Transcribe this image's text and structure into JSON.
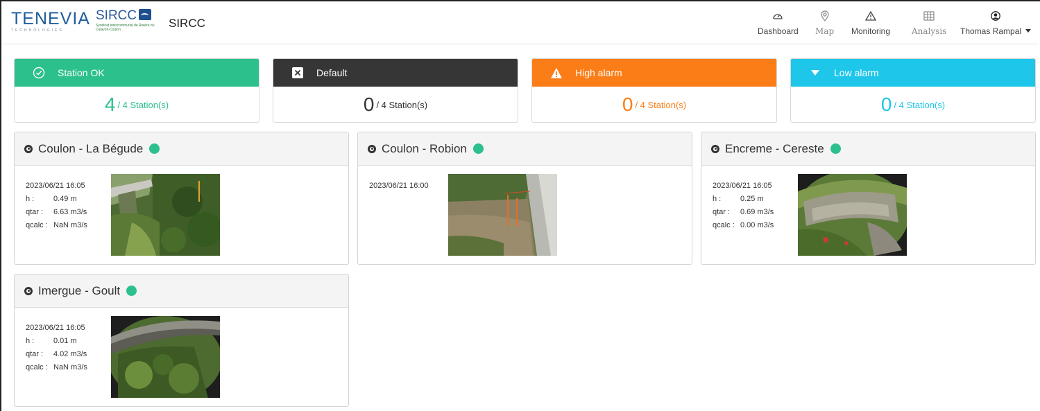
{
  "header": {
    "logo_main": "TENEVIA",
    "logo_main_sub": "TECHNOLOGIES",
    "logo_partner": "SIRCC",
    "logo_partner_tag": "Syndicat Intercommunal de Rivière du Calavon-Coulon",
    "app_title": "SIRCC"
  },
  "nav": {
    "dashboard": {
      "label": "Dashboard",
      "icon": "gauge-icon"
    },
    "map": {
      "label": "Map",
      "icon": "map-pin-icon"
    },
    "monitoring": {
      "label": "Monitoring",
      "icon": "warning-icon"
    },
    "analysis": {
      "label": "Analysis",
      "icon": "table-icon"
    },
    "user": {
      "label": "Thomas Rampal",
      "icon": "user-circle-icon"
    }
  },
  "summary": [
    {
      "label": "Station OK",
      "count": "4",
      "total": "/ 4 Station(s)",
      "color": "#2cc08d",
      "icon": "check-circle-icon"
    },
    {
      "label": "Default",
      "count": "0",
      "total": "/ 4 Station(s)",
      "color": "#363636",
      "icon": "x-box-icon"
    },
    {
      "label": "High alarm",
      "count": "0",
      "total": "/ 4 Station(s)",
      "color": "#fb7d17",
      "icon": "warning-triangle-icon"
    },
    {
      "label": "Low alarm",
      "count": "0",
      "total": "/ 4 Station(s)",
      "color": "#1ec6ea",
      "icon": "triangle-down-icon"
    }
  ],
  "stations": [
    {
      "name": "Coulon - La Bégude",
      "status_color": "#2cc08d",
      "timestamp": "2023/06/21 16:05",
      "h_label": "h :",
      "h": "0.49 m",
      "qtar_label": "qtar :",
      "qtar": "6.63 m3/s",
      "qcalc_label": "qcalc :",
      "qcalc": "NaN m3/s"
    },
    {
      "name": "Coulon - Robion",
      "status_color": "#2cc08d",
      "timestamp": "2023/06/21 16:00"
    },
    {
      "name": "Encreme - Cereste",
      "status_color": "#2cc08d",
      "timestamp": "2023/06/21 16:05",
      "h_label": "h :",
      "h": "0.25 m",
      "qtar_label": "qtar :",
      "qtar": "0.69 m3/s",
      "qcalc_label": "qcalc :",
      "qcalc": "0.00 m3/s"
    },
    {
      "name": "Imergue - Goult",
      "status_color": "#2cc08d",
      "timestamp": "2023/06/21 16:05",
      "h_label": "h :",
      "h": "0.01 m",
      "qtar_label": "qtar :",
      "qtar": "4.02 m3/s",
      "qcalc_label": "qcalc :",
      "qcalc": "NaN m3/s"
    }
  ]
}
